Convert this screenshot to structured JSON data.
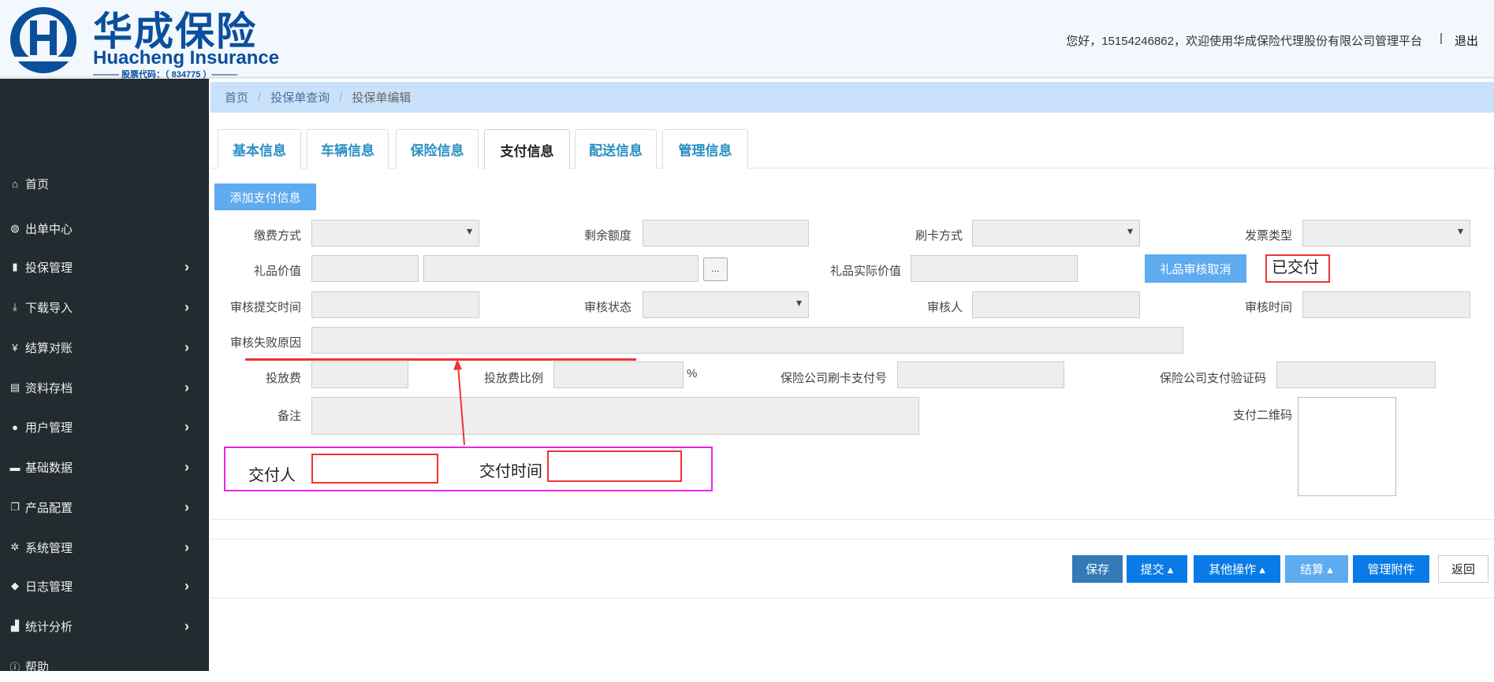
{
  "header": {
    "logo_cn": "华成保险",
    "logo_en": "Huacheng Insurance",
    "logo_code": "——— 股票代码：（ 834775 ）———",
    "welcome": "您好，15154246862，欢迎使用华成保险代理股份有限公司管理平台",
    "separator": "|",
    "logout": "退出"
  },
  "sidebar": {
    "items": [
      {
        "label": "首页",
        "icon": "home-icon",
        "glyph": "⌂"
      },
      {
        "label": "出单中心",
        "icon": "globe-icon",
        "glyph": "◍"
      },
      {
        "label": "投保管理",
        "icon": "file-icon",
        "glyph": "▮"
      },
      {
        "label": "下载导入",
        "icon": "download-icon",
        "glyph": "⤓"
      },
      {
        "label": "结算对账",
        "icon": "yen-icon",
        "glyph": "¥"
      },
      {
        "label": "资料存档",
        "icon": "archive-icon",
        "glyph": "▤"
      },
      {
        "label": "用户管理",
        "icon": "user-icon",
        "glyph": "●"
      },
      {
        "label": "基础数据",
        "icon": "drive-icon",
        "glyph": "▬"
      },
      {
        "label": "产品配置",
        "icon": "copy-icon",
        "glyph": "❐"
      },
      {
        "label": "系统管理",
        "icon": "gear-icon",
        "glyph": "✲"
      },
      {
        "label": "日志管理",
        "icon": "tags-icon",
        "glyph": "◆"
      },
      {
        "label": "统计分析",
        "icon": "bar-chart-icon",
        "glyph": "▟"
      },
      {
        "label": "帮助",
        "icon": "info-icon",
        "glyph": "ⓘ"
      }
    ],
    "chevron": "›"
  },
  "breadcrumb": {
    "items": [
      "首页",
      "投保单查询",
      "投保单编辑"
    ],
    "sep": "/"
  },
  "tabs": [
    "基本信息",
    "车辆信息",
    "保险信息",
    "支付信息",
    "配送信息",
    "管理信息"
  ],
  "form": {
    "add_button": "添加支付信息",
    "labels": {
      "pay_method": "缴费方式",
      "remaining": "剩余额度",
      "card_method": "刷卡方式",
      "invoice_type": "发票类型",
      "gift_value": "礼品价值",
      "gift_actual": "礼品实际价值",
      "submit_time": "审核提交时间",
      "audit_status": "审核状态",
      "auditor": "审核人",
      "audit_time": "审核时间",
      "fail_reason": "审核失败原因",
      "fee": "投放费",
      "fee_ratio": "投放费比例",
      "percent": "%",
      "card_pay_no": "保险公司刷卡支付号",
      "verify_code": "保险公司支付验证码",
      "remark": "备注",
      "qr": "支付二维码"
    },
    "ellipsis": "...",
    "gift_cancel_button": "礼品审核取消",
    "paid_status": "已交付",
    "annotation": {
      "payer": "交付人",
      "pay_time": "交付时间"
    }
  },
  "actions": {
    "save": "保存",
    "submit": "提交 ▴",
    "other": "其他操作 ▴",
    "settle": "结算 ▴",
    "attach": "管理附件",
    "back": "返回"
  }
}
